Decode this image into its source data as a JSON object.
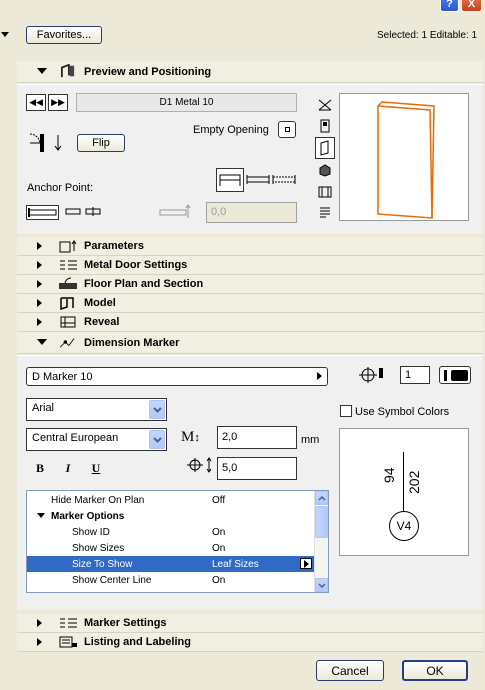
{
  "toolbar": {
    "favorites_label": "Favorites...",
    "selected_info": "Selected: 1 Editable: 1"
  },
  "title_bar": {
    "help_label": "?",
    "close_label": "X"
  },
  "preview": {
    "section_title": "Preview and Positioning",
    "door_name": "D1 Metal 10",
    "empty_opening_label": "Empty Opening",
    "flip_label": "Flip",
    "anchor_point_label": "Anchor Point:",
    "offset_value": "0,0"
  },
  "sections": [
    {
      "label": "Parameters"
    },
    {
      "label": "Metal Door Settings"
    },
    {
      "label": "Floor Plan and Section"
    },
    {
      "label": "Model"
    },
    {
      "label": "Reveal"
    }
  ],
  "dimension_marker": {
    "section_title": "Dimension Marker",
    "marker_type": "D Marker 10",
    "pen_number": "1",
    "font": "Arial",
    "encoding": "Central European",
    "text_size": "2,0",
    "unit": "mm",
    "offset": "5,0",
    "use_symbol_colors_label": "Use Symbol Colors",
    "bold_label": "B",
    "italic_label": "I",
    "underline_label": "U",
    "preview": {
      "width_value": "94",
      "height_value": "202",
      "tag": "V4"
    },
    "options": [
      {
        "key": "Hide Marker On Plan",
        "value": "Off",
        "group": false,
        "selected": false
      },
      {
        "key": "Marker Options",
        "value": "",
        "group": true,
        "selected": false
      },
      {
        "key": "Show ID",
        "value": "On",
        "group": false,
        "selected": false
      },
      {
        "key": "Show  Sizes",
        "value": "On",
        "group": false,
        "selected": false
      },
      {
        "key": "Size To Show",
        "value": "Leaf Sizes",
        "group": false,
        "selected": true
      },
      {
        "key": "Show Center Line",
        "value": "On",
        "group": false,
        "selected": false
      }
    ]
  },
  "bottom_sections": [
    {
      "label": "Marker Settings"
    },
    {
      "label": "Listing and Labeling"
    }
  ],
  "footer": {
    "cancel_label": "Cancel",
    "ok_label": "OK"
  },
  "colors": {
    "selection": "#316ac5",
    "door_edge": "#e46c0a",
    "accent": "#0a246a"
  }
}
